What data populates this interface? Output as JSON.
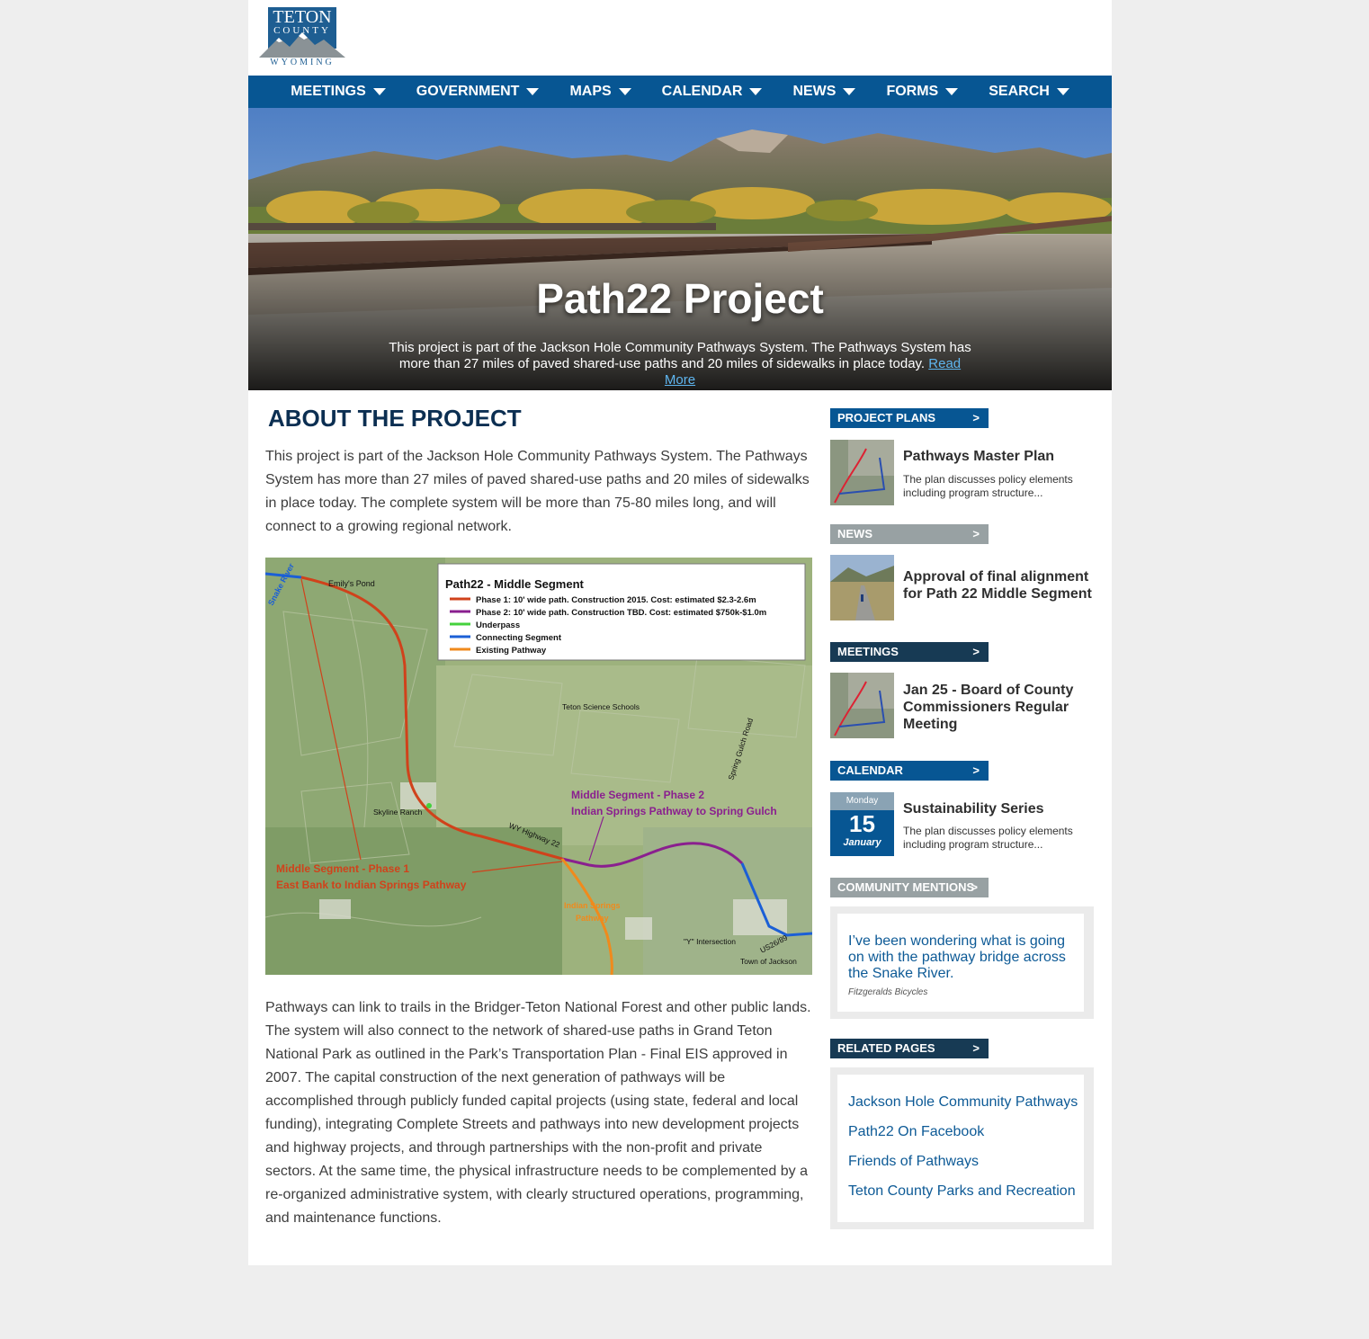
{
  "logo": {
    "line1": "TETON",
    "line2": "COUNTY",
    "line3": "WYOMING"
  },
  "nav": [
    {
      "label": "MEETINGS"
    },
    {
      "label": "GOVERNMENT"
    },
    {
      "label": "MAPS"
    },
    {
      "label": "CALENDAR"
    },
    {
      "label": "NEWS"
    },
    {
      "label": "FORMS"
    },
    {
      "label": "SEARCH"
    }
  ],
  "hero": {
    "title": "Path22 Project",
    "text": "This project is part of the Jackson Hole Community Pathways System. The Pathways System has more than 27 miles of paved shared-use paths and 20 miles of sidewalks in place today.",
    "link": "Read More"
  },
  "main": {
    "heading": "ABOUT THE PROJECT",
    "para1": "This project is part of the Jackson Hole Community Pathways System. The Pathways System has more than 27 miles of paved shared-use paths and 20 miles of sidewalks in place today. The complete system will be more than 75-80 miles long, and will connect to a growing regional network.",
    "para2": "Pathways can link to trails in the Bridger-Teton National Forest and other public lands. The system will also connect to the network of shared-use paths in Grand Teton National Park as outlined in the Park’s Transportation Plan - Final EIS approved in 2007. The capital construction of the next generation of pathways will be accomplished through publicly funded capital projects (using state, federal and local funding), integrating Complete Streets and pathways into new development projects and highway projects, and through partnerships with the non-profit and private sectors. At the same time, the physical infrastructure needs to be complemented by a re-organized administrative system, with clearly structured operations, programming, and maintenance functions."
  },
  "map": {
    "legend_title": "Path22 - Middle Segment",
    "legend": [
      {
        "label": "Phase 1: 10' wide path. Construction 2015. Cost: estimated $2.3-2.6m",
        "color": "#d0421b"
      },
      {
        "label": "Phase 2: 10' wide path. Construction TBD. Cost: estimated $750k-$1.0m",
        "color": "#8a1f8f"
      },
      {
        "label": "Underpass",
        "color": "#44d13c"
      },
      {
        "label": "Connecting Segment",
        "color": "#1b5fd6"
      },
      {
        "label": "Existing Pathway",
        "color": "#f08a1c"
      }
    ],
    "labels": {
      "snake_river": "Snake River",
      "emilys_pond": "Emily's Pond",
      "teton_science": "Teton Science Schools",
      "spring_gulch": "Spring Gulch Road",
      "skyline": "Skyline Ranch",
      "wy22": "WY Highway 22",
      "phase2_a": "Middle Segment - Phase 2",
      "phase2_b": "Indian Springs Pathway to Spring Gulch",
      "phase1_a": "Middle Segment - Phase 1",
      "phase1_b": "East Bank to Indian Springs Pathway",
      "indian_a": "Indian Springs",
      "indian_b": "Pathway",
      "y_int": "\"Y\" Intersection",
      "us26": "US26/89",
      "town": "Town of Jackson"
    }
  },
  "sidebar": {
    "plans": {
      "head": "PROJECT PLANS",
      "arrow": ">",
      "title": "Pathways Master Plan",
      "desc": "The plan discusses policy elements including program structure..."
    },
    "news": {
      "head": "NEWS",
      "arrow": ">",
      "title": "Approval of final alignment for Path 22 Middle Segment"
    },
    "meetings": {
      "head": "MEETINGS",
      "arrow": ">",
      "title": "Jan 25 - Board of County Commissioners Regular Meeting"
    },
    "calendar": {
      "head": "CALENDAR",
      "arrow": ">",
      "day": "Monday",
      "num": "15",
      "month": "January",
      "title": "Sustainability Series",
      "desc": "The plan discusses policy elements including program structure..."
    },
    "mentions": {
      "head": "COMMUNITY MENTIONS",
      "arrow": ">",
      "quote": "I’ve been wondering what is going on with the pathway bridge across the Snake River.",
      "source": "Fitzgeralds Bicycles"
    },
    "related": {
      "head": "RELATED PAGES",
      "arrow": ">",
      "links": [
        "Jackson Hole Community Pathways",
        "Path22 On Facebook",
        "Friends of Pathways",
        "Teton County Parks and Recreation"
      ]
    }
  },
  "colors": {
    "brand_blue": "#075693",
    "navy": "#173a54",
    "grey": "#98a1a3",
    "link": "#0d5a96"
  }
}
